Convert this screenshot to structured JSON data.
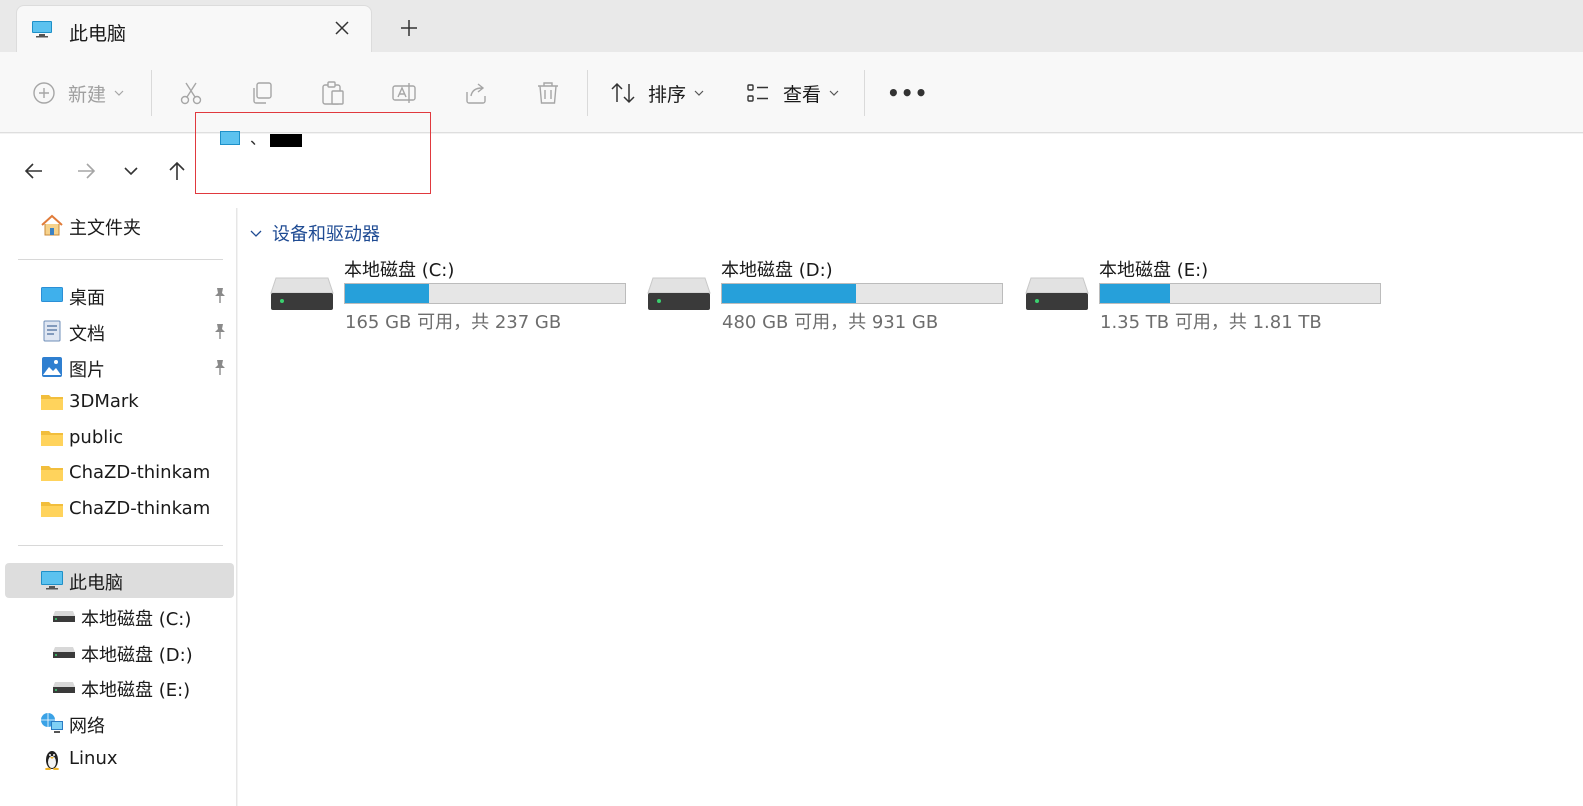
{
  "window": {
    "tab_title": "此电脑",
    "new_tab_label": "+"
  },
  "toolbar": {
    "new_label": "新建",
    "sort_label": "排序",
    "view_label": "查看",
    "more_label": "•••"
  },
  "highlight": {
    "text": "、"
  },
  "sidebar": {
    "home": "主文件夹",
    "quick": [
      {
        "label": "桌面",
        "icon": "desktop-icon",
        "pinned": true
      },
      {
        "label": "文档",
        "icon": "documents-icon",
        "pinned": true
      },
      {
        "label": "图片",
        "icon": "pictures-icon",
        "pinned": true
      },
      {
        "label": "3DMark",
        "icon": "folder-icon",
        "pinned": false
      },
      {
        "label": "public",
        "icon": "folder-icon",
        "pinned": false
      },
      {
        "label": "ChaZD-thinkam",
        "icon": "folder-icon",
        "pinned": false
      },
      {
        "label": "ChaZD-thinkam",
        "icon": "folder-icon",
        "pinned": false
      }
    ],
    "this_pc": "此电脑",
    "drives": [
      "本地磁盘 (C:)",
      "本地磁盘 (D:)",
      "本地磁盘 (E:)"
    ],
    "network": "网络",
    "linux": "Linux"
  },
  "main": {
    "group_title": "设备和驱动器",
    "drives": [
      {
        "name": "本地磁盘 (C:)",
        "free_text": "165 GB 可用，共 237 GB",
        "used_fraction": 0.3
      },
      {
        "name": "本地磁盘 (D:)",
        "free_text": "480 GB 可用，共 931 GB",
        "used_fraction": 0.48
      },
      {
        "name": "本地磁盘 (E:)",
        "free_text": "1.35 TB 可用，共 1.81 TB",
        "used_fraction": 0.25
      }
    ]
  },
  "colors": {
    "accent": "#26a0da",
    "group_text": "#1f4b93",
    "highlight_border": "#e0393e"
  }
}
